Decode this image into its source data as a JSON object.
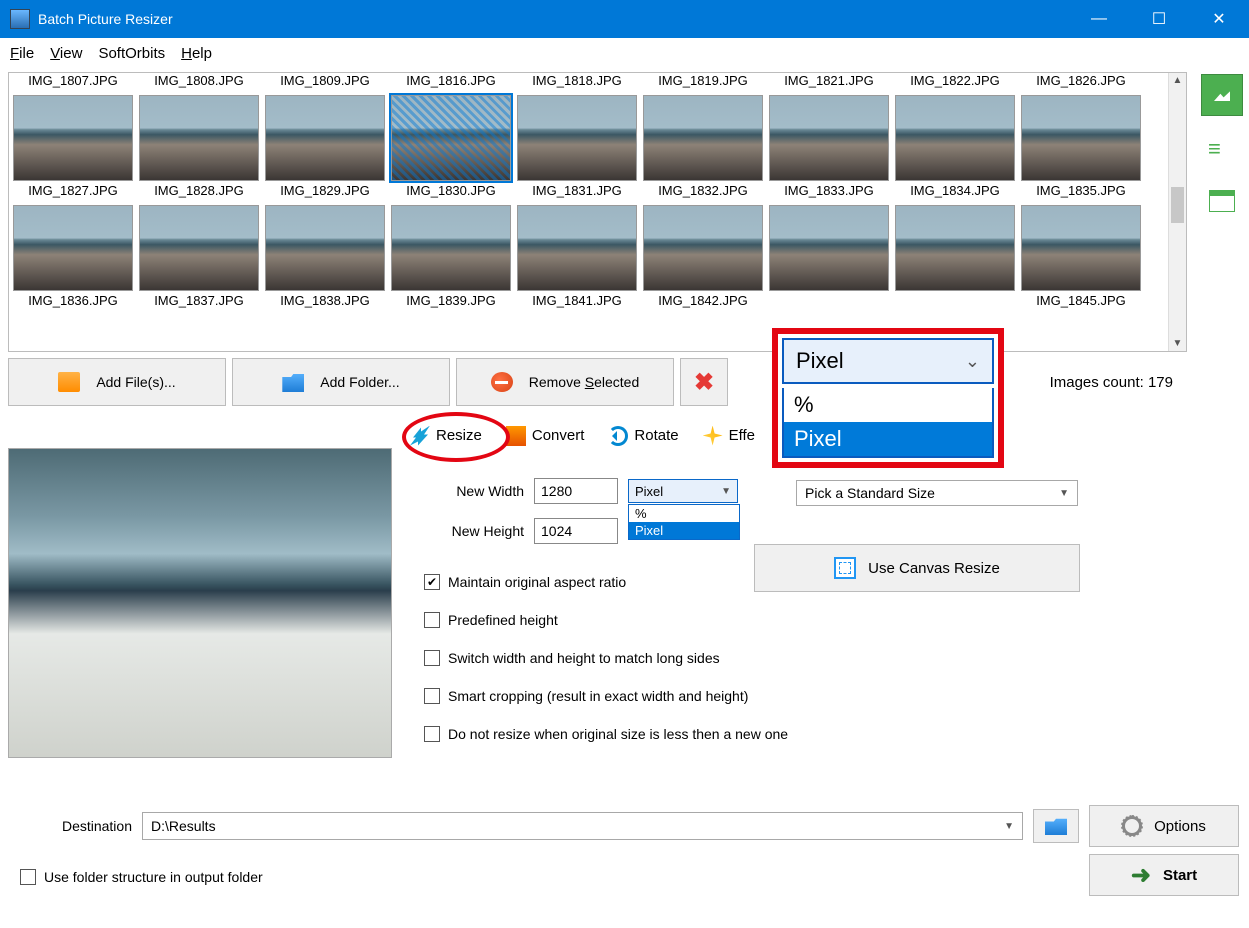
{
  "window": {
    "title": "Batch Picture Resizer"
  },
  "menu": {
    "file": "File",
    "view": "View",
    "softorbits": "SoftOrbits",
    "help": "Help"
  },
  "thumbs": {
    "row1": [
      "IMG_1807.JPG",
      "IMG_1808.JPG",
      "IMG_1809.JPG",
      "IMG_1816.JPG",
      "IMG_1818.JPG",
      "IMG_1819.JPG",
      "IMG_1821.JPG",
      "IMG_1822.JPG",
      "IMG_1826.JPG"
    ],
    "row2": [
      "IMG_1827.JPG",
      "IMG_1828.JPG",
      "IMG_1829.JPG",
      "IMG_1830.JPG",
      "IMG_1831.JPG",
      "IMG_1832.JPG",
      "IMG_1833.JPG",
      "IMG_1834.JPG",
      "IMG_1835.JPG"
    ],
    "row3cut": [
      "IMG_1836.JPG",
      "IMG_1837.JPG",
      "IMG_1838.JPG",
      "IMG_1839.JPG",
      "IMG_1841.JPG",
      "IMG_1842.JPG",
      "",
      "",
      "IMG_1845.JPG"
    ],
    "selected_index_row2": 3
  },
  "toolbar": {
    "add_files": "Add File(s)...",
    "add_folder": "Add Folder...",
    "remove_selected": "Remove Selected",
    "count_label": "Images count: 179"
  },
  "tabs": {
    "resize": "Resize",
    "convert": "Convert",
    "rotate": "Rotate",
    "effects_cut": "Effe"
  },
  "resize": {
    "new_width_label": "New Width",
    "new_height_label": "New Height",
    "width_value": "1280",
    "height_value": "1024",
    "unit_selected": "Pixel",
    "unit_options": {
      "percent": "%",
      "pixel": "Pixel"
    },
    "std_size_placeholder": "Pick a Standard Size",
    "canvas_btn": "Use Canvas Resize",
    "maintain_ratio": "Maintain original aspect ratio",
    "predefined_height": "Predefined height",
    "switch_sides": "Switch width and height to match long sides",
    "smart_crop": "Smart cropping (result in exact width and height)",
    "no_upscale": "Do not resize when original size is less then a new one"
  },
  "magnify": {
    "combo_value": "Pixel",
    "opt_percent": "%",
    "opt_pixel": "Pixel"
  },
  "bottom": {
    "destination_label": "Destination",
    "destination_value": "D:\\Results",
    "use_folder_structure": "Use folder structure in output folder",
    "options": "Options",
    "start": "Start"
  }
}
